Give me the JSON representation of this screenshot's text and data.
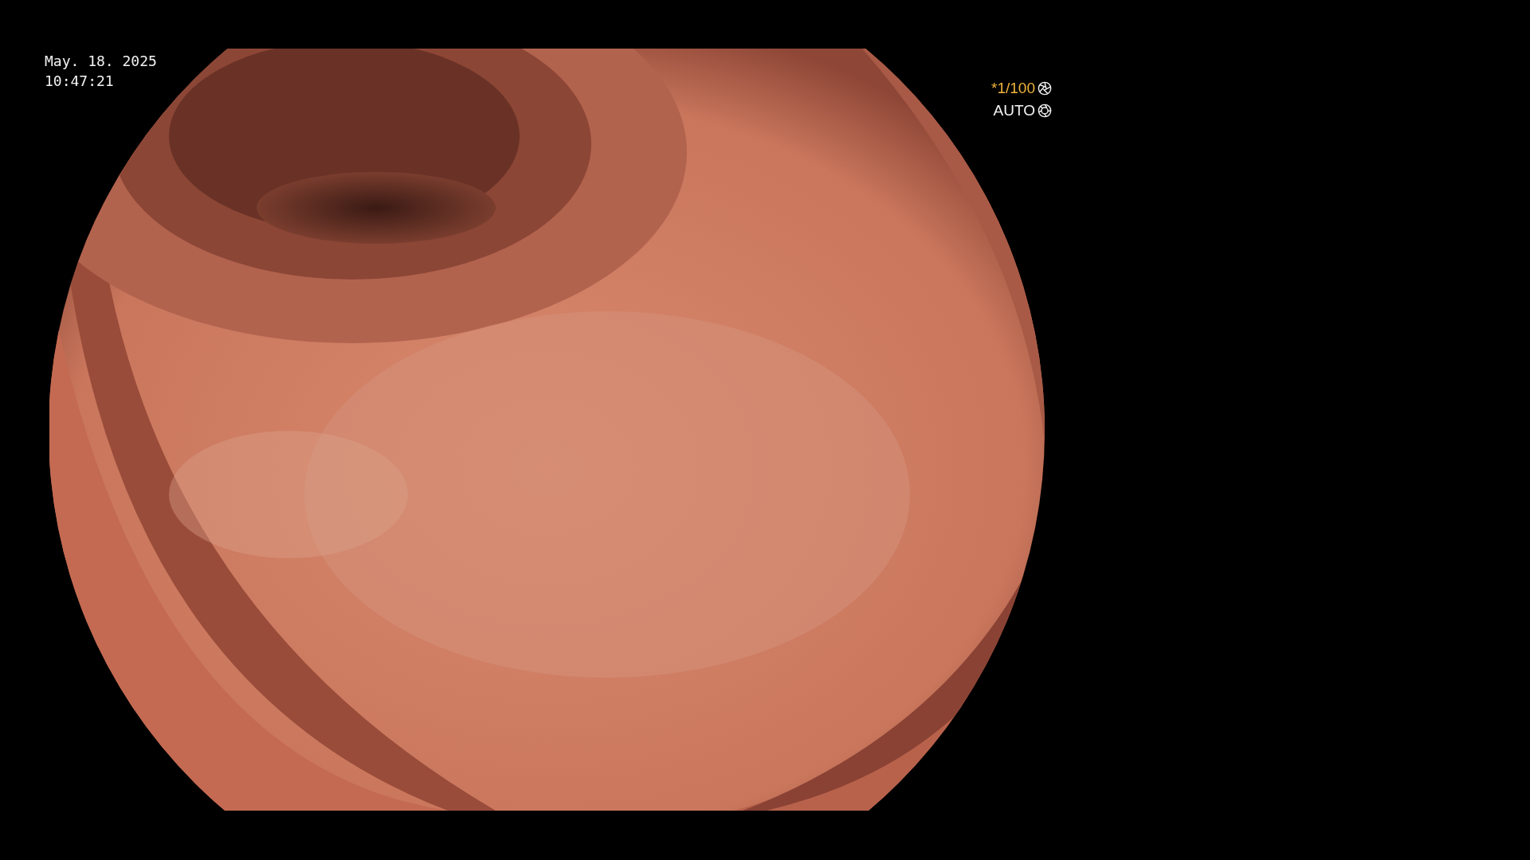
{
  "datetime": {
    "date": "May. 18. 2025",
    "time": "10:47:21"
  },
  "camera": {
    "shutter": "*1/100",
    "iris": "AUTO"
  }
}
